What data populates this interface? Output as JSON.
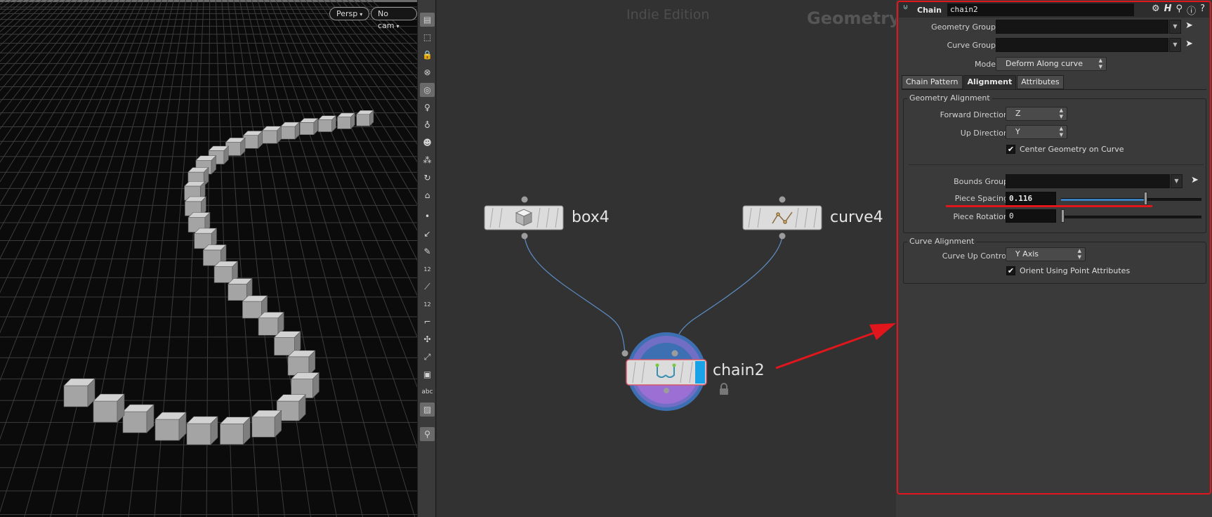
{
  "viewport": {
    "camera_label": "Persp",
    "cam_label": "No cam",
    "caret": "▾"
  },
  "toolbar": {
    "icons": [
      "view-icon",
      "select-icon",
      "lock-icon",
      "ghost-icon",
      "display-icon",
      "light-icon",
      "light-skull-icon",
      "skeleton-icon",
      "points-icon",
      "orbit-icon",
      "camera-icon",
      "point-dot-icon",
      "normal-icon",
      "pencil-icon",
      "number-12-icon",
      "brush-icon",
      "number-12b-icon",
      "ruler-icon",
      "transform-icon",
      "snap-icon",
      "cube-display-icon",
      "text-icon",
      "image-icon",
      "map-pin-icon"
    ],
    "badge_12": "12",
    "text_abc": "abc"
  },
  "network": {
    "watermark": "Indie Edition",
    "context_label": "Geometry",
    "nodes": [
      {
        "name": "box4"
      },
      {
        "name": "curve4"
      },
      {
        "name": "chain2"
      }
    ]
  },
  "params": {
    "header": {
      "node_type": "Chain",
      "node_name": "chain2",
      "icons": [
        "gear-icon",
        "houdini-help-icon",
        "search-icon",
        "info-icon",
        "help-icon"
      ]
    },
    "geometry_group_label": "Geometry Group",
    "geometry_group_value": "",
    "curve_group_label": "Curve Group",
    "curve_group_value": "",
    "mode_label": "Mode",
    "mode_value": "Deform Along curve",
    "tabs": [
      {
        "label": "Chain Pattern",
        "active": false
      },
      {
        "label": "Alignment",
        "active": true
      },
      {
        "label": "Attributes",
        "active": false
      }
    ],
    "geometry_alignment": {
      "title": "Geometry Alignment",
      "forward_direction_label": "Forward Direction",
      "forward_direction_value": "Z",
      "up_direction_label": "Up Direction",
      "up_direction_value": "Y",
      "center_geometry_label": "Center Geometry on Curve",
      "center_geometry_checked": true,
      "bounds_group_label": "Bounds Group",
      "bounds_group_value": "",
      "piece_spacing_label": "Piece Spacing",
      "piece_spacing_value": "0.116",
      "piece_spacing_slider": 0.6,
      "piece_rotation_label": "Piece Rotation",
      "piece_rotation_value": "0",
      "piece_rotation_slider": 0.0
    },
    "curve_alignment": {
      "title": "Curve Alignment",
      "curve_up_control_label": "Curve Up Control",
      "curve_up_control_value": "Y Axis",
      "orient_label": "Orient Using Point Attributes",
      "orient_checked": true
    }
  },
  "colors": {
    "annotation_red": "#e0161c",
    "slider_blue": "#3c7fbf",
    "node_ring_blue": "#3d6fb3",
    "node_ring_purple": "#9b6fd3"
  }
}
